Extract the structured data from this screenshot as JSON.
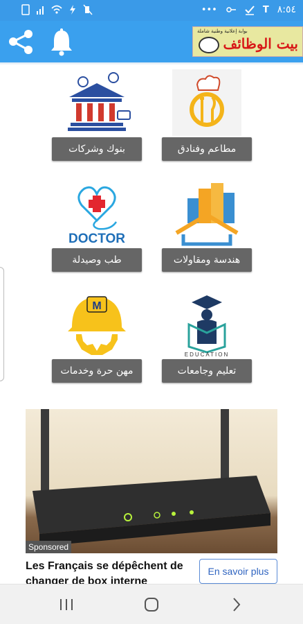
{
  "status_bar": {
    "time": "٨:٥٤",
    "icons": [
      "sim-icon",
      "signal-icon",
      "wifi-icon",
      "battery-saver-icon",
      "mute-icon",
      "more-dots-icon",
      "key-icon",
      "check-icon",
      "t-icon"
    ]
  },
  "app_bar": {
    "share_icon": "share-icon",
    "bell_icon": "bell-icon",
    "brand": {
      "tagline": "بوابة إعلانية وطنية شاملة",
      "name": "بيت الوظائف"
    },
    "colors": {
      "status": "#3a9ae8",
      "bar": "#3aa0ee"
    }
  },
  "categories": [
    {
      "label": "مطاعم وفنادق",
      "icon": "chef-plate-icon"
    },
    {
      "label": "بنوك وشركات",
      "icon": "bank-icon"
    },
    {
      "label": "هندسة ومقاولات",
      "icon": "buildings-icon"
    },
    {
      "label": "طب وصيدلة",
      "icon": "doctor-heart-icon",
      "icon_text": "DOCTOR"
    },
    {
      "label": "تعليم وجامعات",
      "icon": "graduate-book-icon",
      "icon_text": "EDUCATION"
    },
    {
      "label": "مهن حرة وخدمات",
      "icon": "helmet-gear-icon",
      "icon_text": "M"
    }
  ],
  "ad": {
    "sponsored": "Sponsored",
    "title": "Les Français se dépêchent de changer de box interne",
    "cta": "En savoir plus",
    "image": "router-photo"
  },
  "nav_bar": {
    "buttons": [
      "recents-icon",
      "home-icon",
      "back-icon"
    ]
  }
}
